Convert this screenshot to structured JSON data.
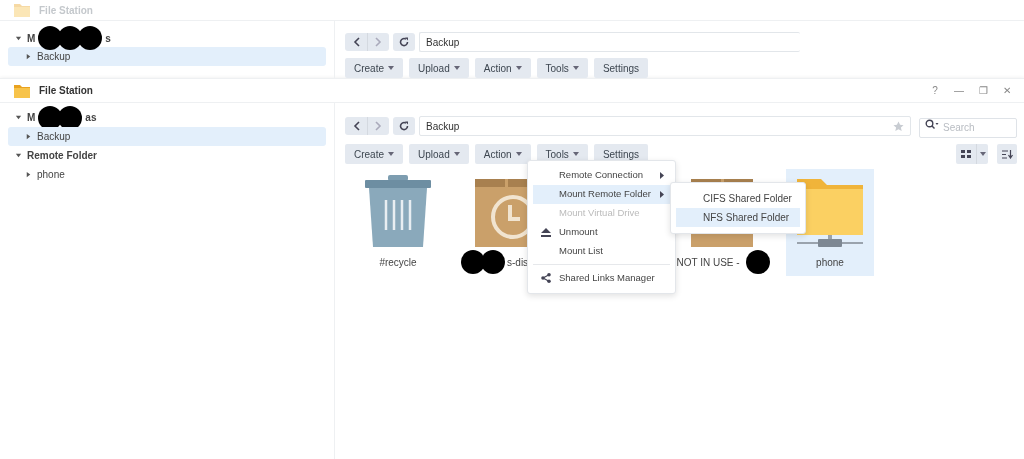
{
  "back_window": {
    "title": "File Station",
    "sidebar": {
      "header_parts": [
        "M",
        "s"
      ],
      "items": [
        {
          "label": "Backup",
          "selected": true
        }
      ]
    },
    "path": "Backup",
    "buttons": [
      {
        "label": "Create",
        "dropdown": true
      },
      {
        "label": "Upload",
        "dropdown": true
      },
      {
        "label": "Action",
        "dropdown": true
      },
      {
        "label": "Tools",
        "dropdown": true
      },
      {
        "label": "Settings",
        "dropdown": false
      }
    ]
  },
  "window": {
    "title": "File Station",
    "controls": [
      "?",
      "—",
      "❐",
      "✕"
    ]
  },
  "sidebar": {
    "groups": [
      {
        "label_parts": [
          "M",
          "as"
        ],
        "items": [
          {
            "label": "Backup",
            "selected": true
          }
        ]
      },
      {
        "label_parts": [
          "Remote Folder"
        ],
        "items": [
          {
            "label": "phone",
            "selected": false
          }
        ]
      }
    ]
  },
  "path": "Backup",
  "search": {
    "placeholder": "Search"
  },
  "buttons": [
    {
      "label": "Create",
      "dropdown": true
    },
    {
      "label": "Upload",
      "dropdown": true
    },
    {
      "label": "Action",
      "dropdown": true
    },
    {
      "label": "Tools",
      "dropdown": true
    },
    {
      "label": "Settings",
      "dropdown": false
    }
  ],
  "files": [
    {
      "kind": "trash",
      "label_parts": [
        {
          "kind": "text",
          "text": "#recycle"
        }
      ],
      "selected": false
    },
    {
      "kind": "backup-box",
      "label_parts": [
        {
          "kind": "redaction"
        },
        {
          "kind": "text",
          "text": "s-dis"
        }
      ],
      "selected": false
    },
    {
      "kind": "box",
      "label_parts": [
        {
          "kind": "text",
          "text": "NOT IN USE -"
        },
        {
          "kind": "redaction"
        }
      ],
      "selected": false
    },
    {
      "kind": "network-folder",
      "label_parts": [
        {
          "kind": "text",
          "text": "phone"
        }
      ],
      "selected": true
    }
  ],
  "menu": {
    "items": [
      {
        "label": "Remote Connection",
        "kind": "plain",
        "submenu": true,
        "disabled": false,
        "selected": false,
        "divider_before": false
      },
      {
        "label": "Mount Remote Folder",
        "kind": "plain",
        "submenu": true,
        "disabled": false,
        "selected": true,
        "divider_before": false
      },
      {
        "label": "Mount Virtual Drive",
        "kind": "plain",
        "submenu": false,
        "disabled": true,
        "selected": false,
        "divider_before": false
      },
      {
        "label": "Unmount",
        "kind": "eject",
        "submenu": false,
        "disabled": false,
        "selected": false,
        "divider_before": false
      },
      {
        "label": "Mount List",
        "kind": "plain",
        "submenu": false,
        "disabled": false,
        "selected": false,
        "divider_before": false
      },
      {
        "label": "Shared Links Manager",
        "kind": "share",
        "submenu": false,
        "disabled": false,
        "selected": false,
        "divider_before": true
      }
    ],
    "submenu": [
      {
        "label": "CIFS Shared Folder",
        "selected": false
      },
      {
        "label": "NFS Shared Folder",
        "selected": true
      }
    ]
  }
}
